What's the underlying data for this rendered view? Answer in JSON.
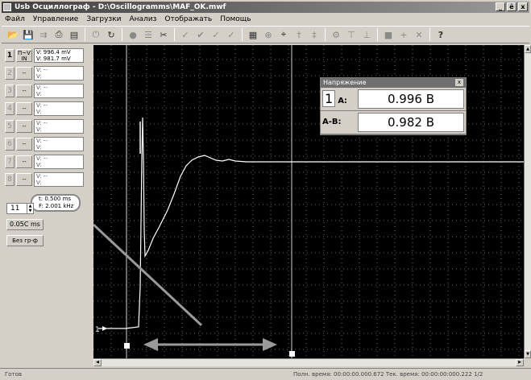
{
  "window": {
    "title": "Usb Осциллограф - D:\\Oscillogramms\\MAF_OK.mwf",
    "min": "_",
    "restore": "ё",
    "close": "x"
  },
  "menu": [
    "Файл",
    "Управление",
    "Загрузки",
    "Анализ",
    "Отображать",
    "Помощь"
  ],
  "channels": [
    {
      "num": "1",
      "btn_top": "П~V",
      "btn_bottom": "IN",
      "v1": "V: 996.4 mV",
      "v2": "V: 981.7 mV",
      "active": true
    },
    {
      "num": "2",
      "btn_top": "--",
      "btn_bottom": "",
      "v1": "V:",
      "v2": "V:",
      "active": false
    },
    {
      "num": "3",
      "btn_top": "--",
      "btn_bottom": "",
      "v1": "V:",
      "v2": "V:",
      "active": false
    },
    {
      "num": "4",
      "btn_top": "--",
      "btn_bottom": "",
      "v1": "V:",
      "v2": "V:",
      "active": false
    },
    {
      "num": "5",
      "btn_top": "--",
      "btn_bottom": "",
      "v1": "V:",
      "v2": "V:",
      "active": false
    },
    {
      "num": "6",
      "btn_top": "--",
      "btn_bottom": "",
      "v1": "V:",
      "v2": "V:",
      "active": false
    },
    {
      "num": "7",
      "btn_top": "--",
      "btn_bottom": "",
      "v1": "V:",
      "v2": "V:",
      "active": false
    },
    {
      "num": "8",
      "btn_top": "--",
      "btn_bottom": "",
      "v1": "V:",
      "v2": "V:",
      "active": false
    }
  ],
  "time_readout": {
    "t": "t: 0.500 ms",
    "f": "F: 2.001 kHz"
  },
  "spin_value": "11",
  "time_scale": "0.05C ms",
  "mode_button": "Без гр-ф",
  "voltage_panel": {
    "title": "Напряжение",
    "close": "x",
    "channel": "1",
    "row_a_label": "А:",
    "row_a_value": "0.996 В",
    "row_ab_label": "А-В:",
    "row_ab_value": "0.982 В"
  },
  "trace_marker": "1",
  "status": {
    "left": "Готов",
    "right": "Полн. время: 00:00:00.000.672   Тек. время: 00:00:00:000.222   1/2"
  },
  "colors": {
    "scope_bg": "#000000",
    "trace": "#ffffff",
    "grid": "#6a6a6a",
    "annotation": "#9a9a9a"
  }
}
